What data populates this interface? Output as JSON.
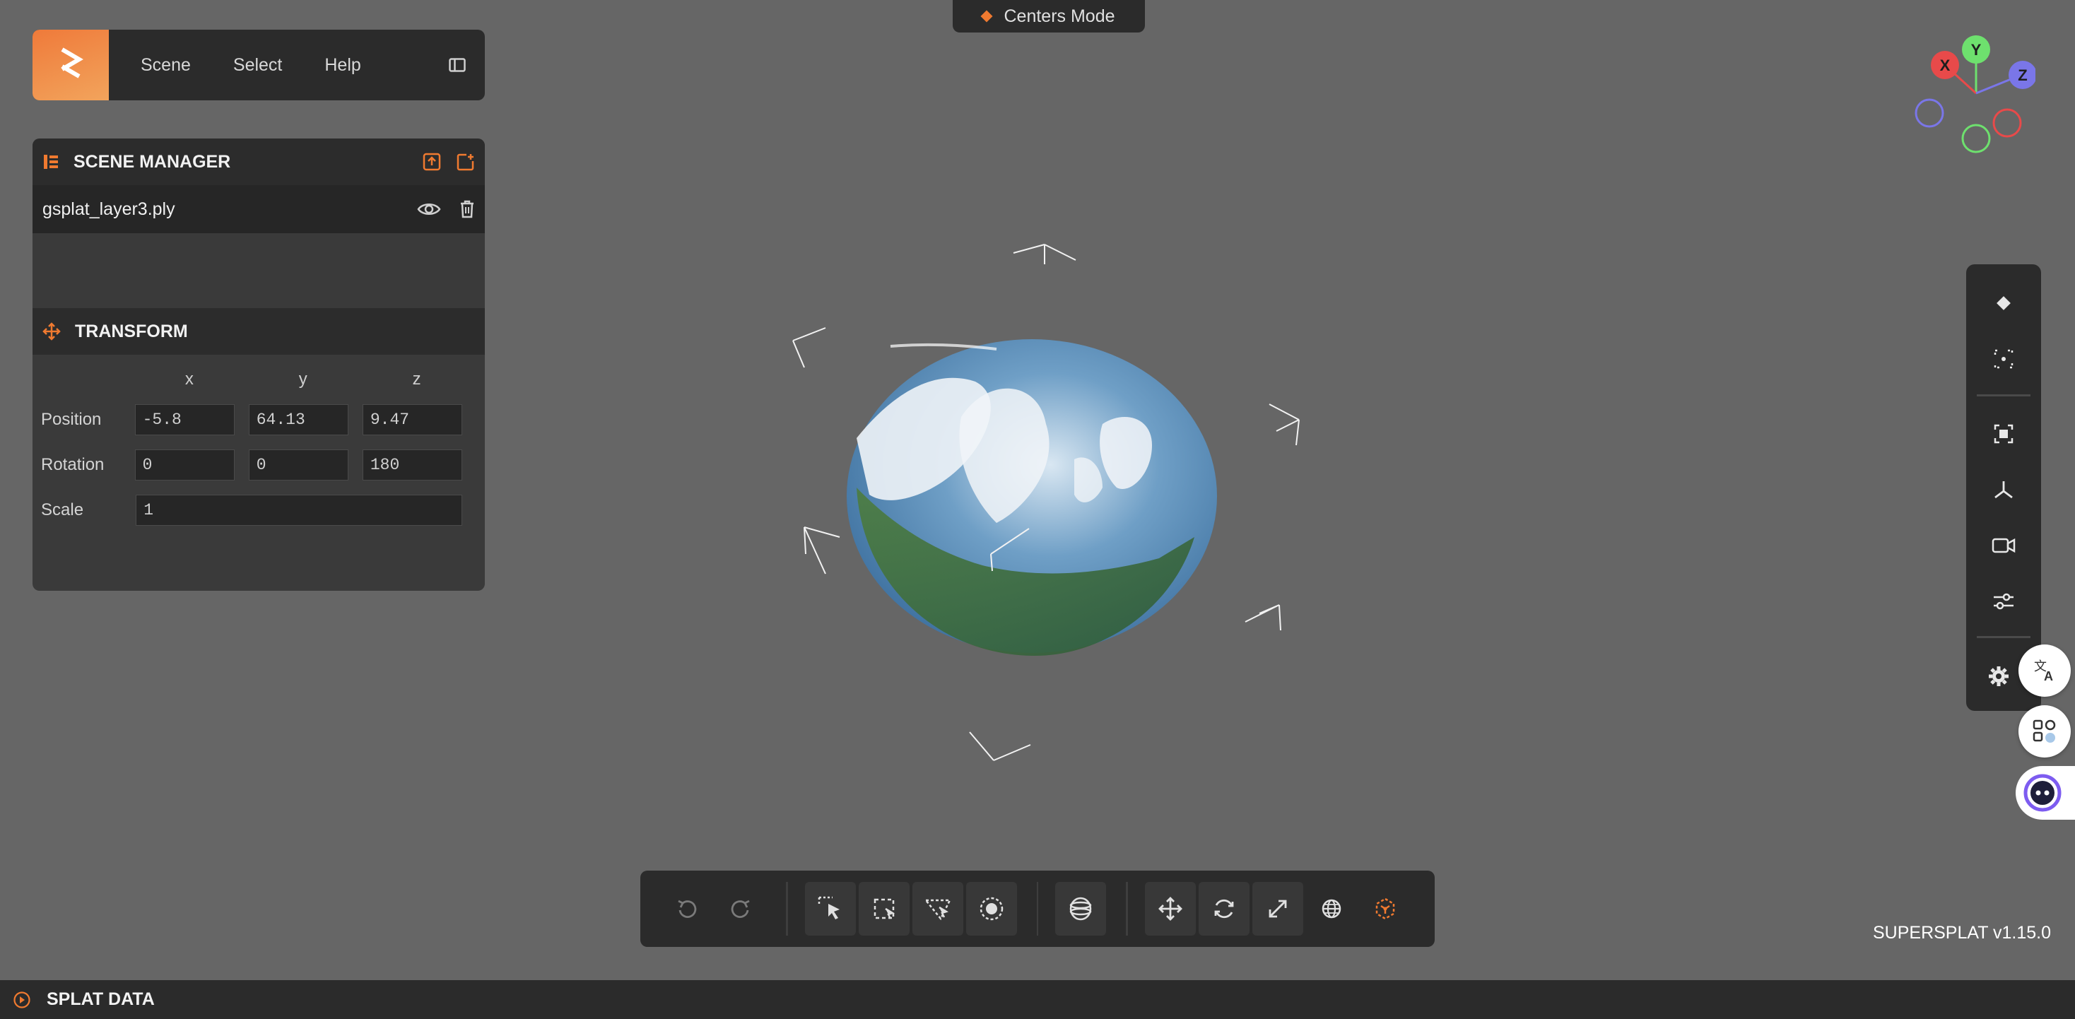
{
  "menu": {
    "items": [
      "Scene",
      "Select",
      "Help"
    ]
  },
  "scene_manager": {
    "title": "SCENE MANAGER",
    "items": [
      {
        "name": "gsplat_layer3.ply"
      }
    ]
  },
  "transform": {
    "title": "TRANSFORM",
    "axes": [
      "x",
      "y",
      "z"
    ],
    "position": {
      "label": "Position",
      "x": "-5.8",
      "y": "64.13",
      "z": "9.47"
    },
    "rotation": {
      "label": "Rotation",
      "x": "0",
      "y": "0",
      "z": "180"
    },
    "scale": {
      "label": "Scale",
      "value": "1"
    }
  },
  "mode_indicator": {
    "label": "Centers Mode",
    "accent": "#f07a30"
  },
  "gizmo": {
    "x_label": "X",
    "y_label": "Y",
    "z_label": "Z",
    "x_color": "#e84a4a",
    "y_color": "#6ee06e",
    "z_color": "#7a76e8"
  },
  "version": "SUPERSPLAT v1.15.0",
  "splat_data": {
    "title": "SPLAT DATA"
  },
  "colors": {
    "accent": "#f07a30",
    "panel": "#2b2b2b",
    "background": "#666666"
  },
  "right_toolbar": {
    "icons": [
      "diamond-icon",
      "focus-center-icon",
      "frame-selection-icon",
      "axes-icon",
      "camera-icon",
      "sliders-icon",
      "gear-icon"
    ]
  },
  "bottom_toolbar": {
    "icons": [
      "undo-icon",
      "redo-icon",
      "picker-select-icon",
      "lasso-select-icon",
      "polygon-select-icon",
      "brush-select-icon",
      "sphere-select-icon",
      "translate-icon",
      "rotate-icon",
      "scale-icon",
      "world-space-icon",
      "local-space-icon"
    ]
  }
}
